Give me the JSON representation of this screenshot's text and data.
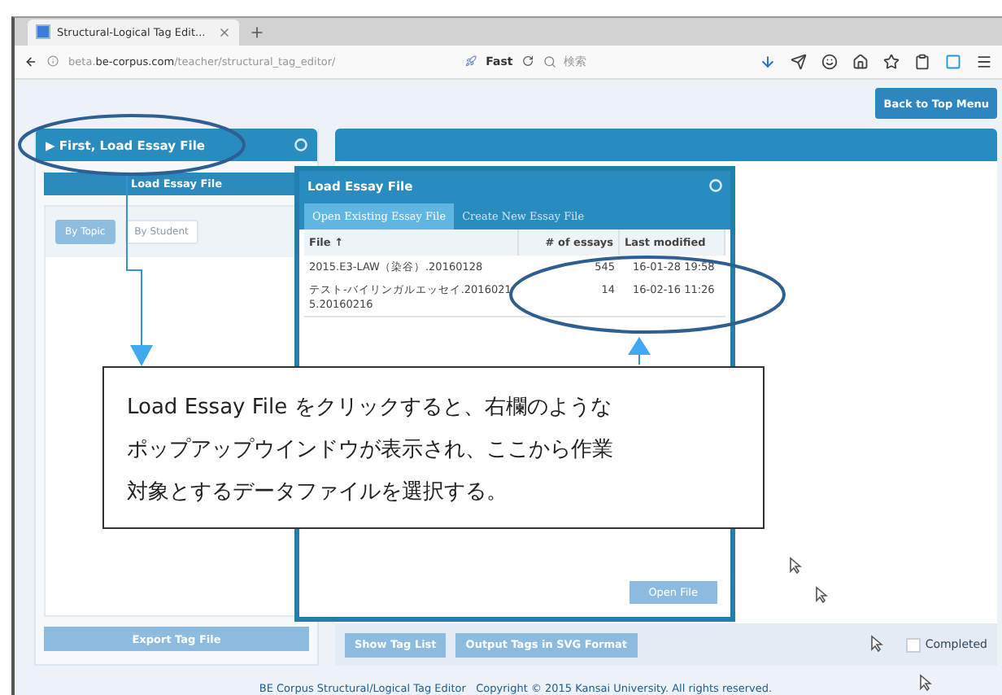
{
  "browser": {
    "tab_title": "Structural-Logical Tag Edit...",
    "url_prefix": "beta.",
    "url_host": "be-corpus.com",
    "url_path": "/teacher/structural_tag_editor/",
    "fast_label": "Fast",
    "search_placeholder": "検索"
  },
  "page": {
    "back_button": "Back to Top Menu",
    "left_panel": {
      "title": "▶ First, Load Essay File",
      "subheader": "Load Essay File",
      "filters": [
        {
          "label": "By Topic",
          "selected": true
        },
        {
          "label": "By Student",
          "selected": false
        }
      ],
      "export_button": "Export Tag File"
    },
    "bottom_bar": {
      "buttons": [
        "Show Tag List",
        "Output Tags in SVG Format"
      ],
      "completed": {
        "label": "Completed",
        "checked": false
      }
    },
    "footer": "BE Corpus Structural/Logical Tag Editor   Copyright © 2015 Kansai University. All rights reserved."
  },
  "dialog": {
    "title": "Load Essay File",
    "tabs": [
      {
        "label": "Open Existing Essay File",
        "selected": true
      },
      {
        "label": "Create New Essay File",
        "selected": false
      }
    ],
    "columns": [
      "File ↑",
      "# of essays",
      "Last modified"
    ],
    "rows": [
      {
        "file": "2015.E3-LAW（染谷）.20160128",
        "essays": "545",
        "modified": "16-01-28 19:58"
      },
      {
        "file": "テスト-バイリンガルエッセイ.20160215.20160216",
        "essays": "14",
        "modified": "16-02-16 11:26"
      }
    ],
    "open_button": "Open File"
  },
  "callout": {
    "lines": [
      "Load Essay File をクリックすると、右欄のような",
      "ポップアップウインドウが表示され、ここから作業",
      "対象とするデータファイルを選択する。"
    ]
  }
}
